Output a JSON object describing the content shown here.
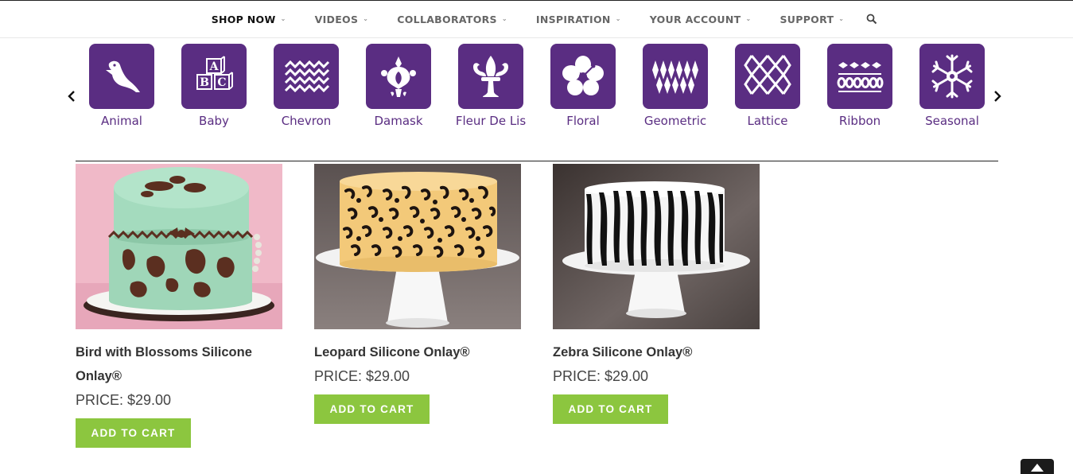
{
  "nav": {
    "items": [
      {
        "label": "SHOP NOW",
        "active": true
      },
      {
        "label": "VIDEOS",
        "active": false
      },
      {
        "label": "COLLABORATORS",
        "active": false
      },
      {
        "label": "INSPIRATION",
        "active": false
      },
      {
        "label": "YOUR ACCOUNT",
        "active": false
      },
      {
        "label": "SUPPORT",
        "active": false
      }
    ],
    "search_icon": "search-icon"
  },
  "categories": [
    {
      "label": "Animal",
      "icon": "bird-icon"
    },
    {
      "label": "Baby",
      "icon": "abc-blocks-icon"
    },
    {
      "label": "Chevron",
      "icon": "chevron-pattern-icon"
    },
    {
      "label": "Damask",
      "icon": "damask-icon"
    },
    {
      "label": "Fleur De Lis",
      "icon": "fleur-de-lis-icon"
    },
    {
      "label": "Floral",
      "icon": "hibiscus-icon"
    },
    {
      "label": "Geometric",
      "icon": "diamonds-icon"
    },
    {
      "label": "Lattice",
      "icon": "lattice-icon"
    },
    {
      "label": "Ribbon",
      "icon": "ribbon-icon"
    },
    {
      "label": "Seasonal",
      "icon": "snowflake-icon"
    }
  ],
  "products": [
    {
      "title": "Bird with Blossoms Silicone Onlay®",
      "price": "PRICE: $29.00",
      "button": "ADD TO CART"
    },
    {
      "title": "Leopard Silicone Onlay®",
      "price": "PRICE: $29.00",
      "button": "ADD TO CART"
    },
    {
      "title": "Zebra Silicone Onlay®",
      "price": "PRICE: $29.00",
      "button": "ADD TO CART"
    }
  ],
  "colors": {
    "brand_purple": "#5a2d82",
    "cart_green": "#8cc63f",
    "text_dark": "#333333"
  }
}
